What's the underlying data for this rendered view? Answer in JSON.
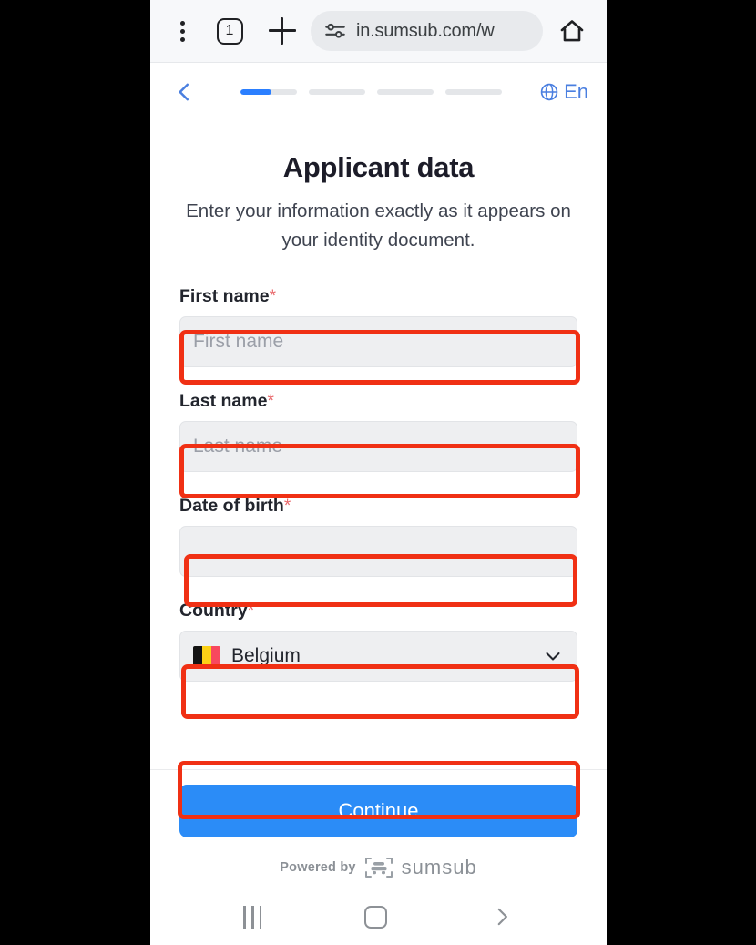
{
  "browser": {
    "menu_icon": "three-dots-icon",
    "tab_count": "1",
    "new_tab_icon": "plus-icon",
    "site_info_icon": "permissions-tune-icon",
    "url": "in.sumsub.com/w",
    "home_icon": "home-icon"
  },
  "stepbar": {
    "back_icon": "chevron-left-icon",
    "globe_icon": "globe-icon",
    "language": "En",
    "progress": {
      "segments": 4,
      "fill_percent": [
        55,
        0,
        0,
        0
      ],
      "active_color": "#2b7fff",
      "track_color": "#e4e6e9"
    }
  },
  "main": {
    "title": "Applicant data",
    "subtitle": "Enter your information exactly as it appears on your identity document.",
    "fields": [
      {
        "label": "First name",
        "required_mark": "*",
        "type": "text",
        "placeholder": "First name",
        "value": ""
      },
      {
        "label": "Last name",
        "required_mark": "*",
        "type": "text",
        "placeholder": "Last name",
        "value": ""
      },
      {
        "label": "Date of birth",
        "required_mark": "*",
        "type": "date",
        "placeholder": "",
        "value": ""
      },
      {
        "label": "Country",
        "required_mark": "*",
        "type": "select",
        "placeholder": "",
        "value": "Belgium",
        "flag": "belgium-flag-icon",
        "flag_colors": [
          "#141414",
          "#fcd116",
          "#f8485e"
        ],
        "chevron_icon": "chevron-down-icon"
      }
    ]
  },
  "cta": {
    "continue_label": "Continue",
    "accent_color": "#2b8cf7"
  },
  "footer": {
    "powered_by": "Powered by",
    "brand": "sumsub",
    "logo_icon": "sumsub-logo-icon"
  },
  "navbar": {
    "recents_icon": "recents-icon",
    "home_icon": "home-square-icon",
    "back_icon": "chevron-right-back-icon"
  },
  "annotations": {
    "highlight_color": "#f03014",
    "boxes": [
      {
        "target": "first-name-input"
      },
      {
        "target": "last-name-input"
      },
      {
        "target": "date-of-birth-input"
      },
      {
        "target": "country-select"
      },
      {
        "target": "continue-button"
      }
    ]
  }
}
